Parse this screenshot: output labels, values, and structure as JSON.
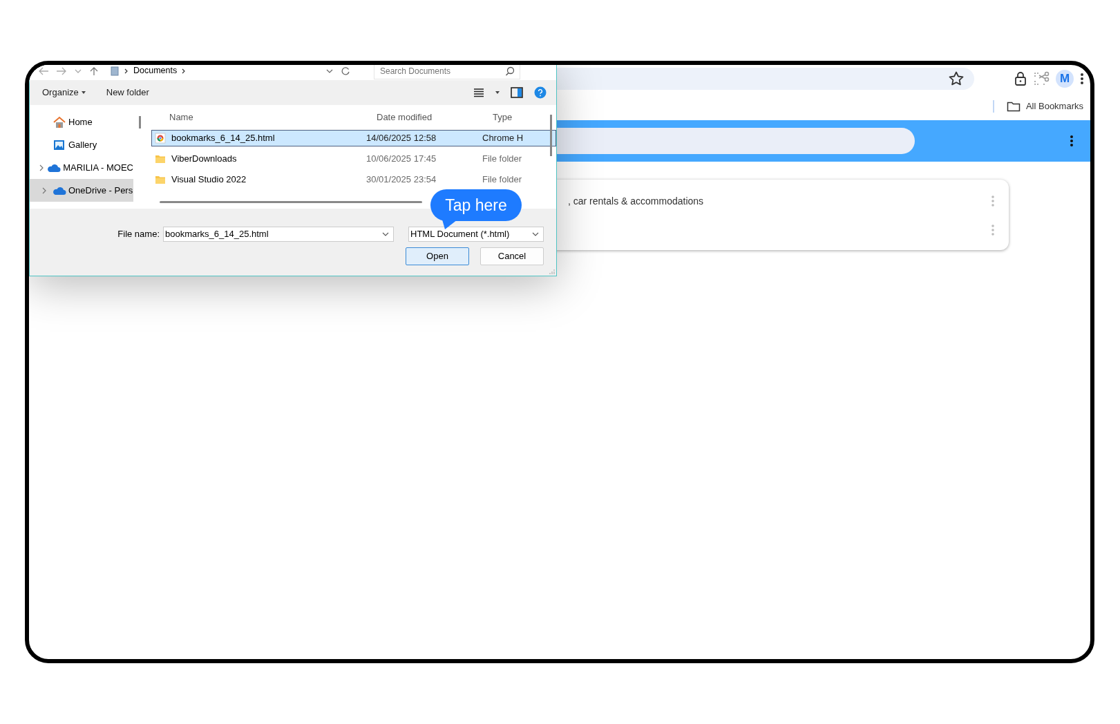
{
  "browser": {
    "profile_initial": "M",
    "bookmarks_folder": "All Bookmarks",
    "card_rows": [
      {
        "text": ", car rentals & accommodations"
      },
      {
        "text": ""
      }
    ]
  },
  "dialog": {
    "path": [
      "Documents"
    ],
    "search": {
      "placeholder": "Search Documents"
    },
    "toolbar": {
      "organize": "Organize",
      "new_folder": "New folder"
    },
    "nav_pane": [
      {
        "label": "Home",
        "kind": "home",
        "has_children": false,
        "selected": false
      },
      {
        "label": "Gallery",
        "kind": "gallery",
        "has_children": false,
        "selected": false
      },
      {
        "label": "MARILIA - MOEC",
        "kind": "cloud",
        "has_children": true,
        "selected": false
      },
      {
        "label": "OneDrive - Pers",
        "kind": "cloud",
        "has_children": true,
        "selected": true
      }
    ],
    "columns": [
      "Name",
      "Date modified",
      "Type"
    ],
    "files": [
      {
        "name": "bookmarks_6_14_25.html",
        "date": "14/06/2025 12:58",
        "type": "Chrome H",
        "kind": "chrome-html",
        "selected": true
      },
      {
        "name": "ViberDownloads",
        "date": "10/06/2025 17:45",
        "type": "File folder",
        "kind": "folder",
        "selected": false
      },
      {
        "name": "Visual Studio 2022",
        "date": "30/01/2025 23:54",
        "type": "File folder",
        "kind": "folder",
        "selected": false
      }
    ],
    "file_name_label": "File name:",
    "file_name": "bookmarks_6_14_25.html",
    "file_type": "HTML Document (*.html)",
    "buttons": [
      {
        "label": "Open",
        "default": true
      },
      {
        "label": "Cancel",
        "default": false
      }
    ]
  },
  "callout": {
    "text": "Tap here"
  }
}
